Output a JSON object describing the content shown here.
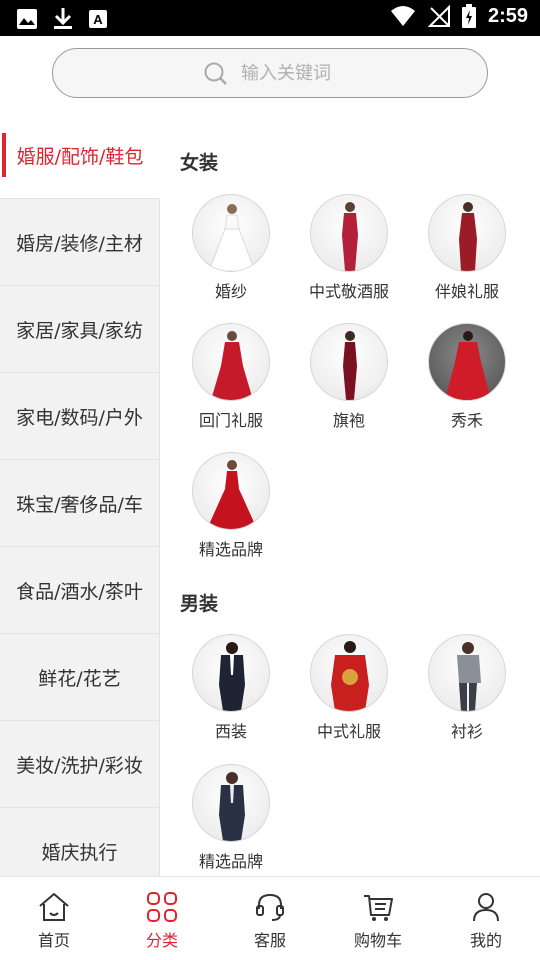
{
  "status_bar": {
    "time": "2:59",
    "left_icons": [
      "image-icon",
      "download-icon",
      "font-a-icon"
    ],
    "right_icons": [
      "wifi-icon",
      "signal-off-icon",
      "battery-icon"
    ]
  },
  "search": {
    "placeholder": "输入关键词",
    "icon": "search-icon"
  },
  "sidebar": {
    "items": [
      {
        "label": "婚服/配饰/鞋包",
        "active": true
      },
      {
        "label": "婚房/装修/主材",
        "active": false
      },
      {
        "label": "家居/家具/家纺",
        "active": false
      },
      {
        "label": "家电/数码/户外",
        "active": false
      },
      {
        "label": "珠宝/奢侈品/车",
        "active": false
      },
      {
        "label": "食品/酒水/茶叶",
        "active": false
      },
      {
        "label": "鲜花/花艺",
        "active": false
      },
      {
        "label": "美妆/洗护/彩妆",
        "active": false
      },
      {
        "label": "婚庆执行",
        "active": false
      }
    ]
  },
  "main": {
    "sections": [
      {
        "title": "女装",
        "items": [
          {
            "label": "婚纱"
          },
          {
            "label": "中式敬酒服"
          },
          {
            "label": "伴娘礼服"
          },
          {
            "label": "回门礼服"
          },
          {
            "label": "旗袍"
          },
          {
            "label": "秀禾"
          },
          {
            "label": "精选品牌"
          }
        ]
      },
      {
        "title": "男装",
        "items": [
          {
            "label": "西装"
          },
          {
            "label": "中式礼服"
          },
          {
            "label": "衬衫"
          },
          {
            "label": "精选品牌"
          }
        ]
      }
    ]
  },
  "tabbar": {
    "tabs": [
      {
        "label": "首页",
        "icon": "home-icon",
        "active": false
      },
      {
        "label": "分类",
        "icon": "category-grid-icon",
        "active": true
      },
      {
        "label": "客服",
        "icon": "headset-icon",
        "active": false
      },
      {
        "label": "购物车",
        "icon": "cart-icon",
        "active": false
      },
      {
        "label": "我的",
        "icon": "user-icon",
        "active": false
      }
    ]
  },
  "colors": {
    "accent": "#e0232f",
    "sidebar_bg": "#f2f2f2",
    "status_bar_bg": "#000000"
  }
}
